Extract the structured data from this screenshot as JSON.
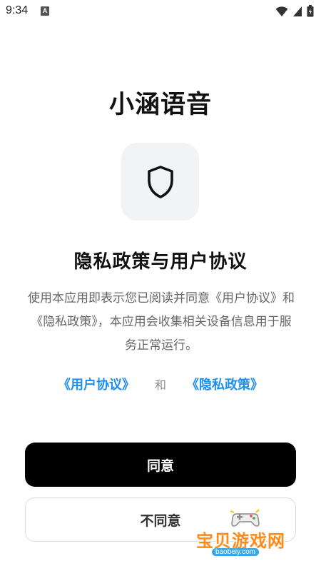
{
  "status_bar": {
    "time": "9:34",
    "notification_letter": "A",
    "icons": [
      "wifi-icon",
      "cell-signal-icon",
      "battery-icon"
    ]
  },
  "app": {
    "title": "小涵语音",
    "shield_icon": "shield-icon"
  },
  "policy": {
    "title": "隐私政策与用户协议",
    "description": "使用本应用即表示您已阅读并同意《用户协议》和《隐私政策》，本应用会收集相关设备信息用于服务正常运行。",
    "user_agreement_link": "《用户协议》",
    "and_label": "和",
    "privacy_policy_link": "《隐私政策》"
  },
  "buttons": {
    "agree": "同意",
    "disagree": "不同意"
  },
  "watermark": {
    "text": "宝贝游戏网",
    "url": "baobeiy.com"
  },
  "colors": {
    "link": "#1e8ef0",
    "primary_button": "#000000",
    "watermark": "#ff8a1a"
  }
}
